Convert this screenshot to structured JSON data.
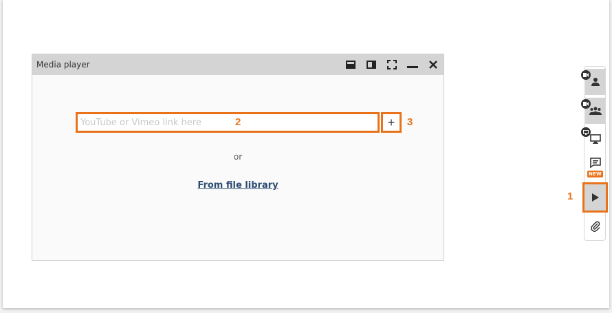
{
  "player": {
    "title": "Media player",
    "input": {
      "value": "",
      "placeholder": "YouTube or Vimeo link here"
    },
    "add_label": "+",
    "or_text": "or",
    "file_library_link": "From file library"
  },
  "callouts": {
    "toolbar_play": "1",
    "link_input": "2",
    "add_button": "3"
  },
  "toolbar": {
    "items": [
      {
        "icon": "user-video-icon"
      },
      {
        "icon": "group-video-icon"
      },
      {
        "icon": "screen-share-icon"
      },
      {
        "icon": "notes-icon",
        "badge": "NEW"
      },
      {
        "icon": "play-icon"
      },
      {
        "icon": "paperclip-icon"
      }
    ]
  },
  "colors": {
    "accent": "#e8731b",
    "titlebar": "#d4d4d4",
    "link": "#2c4a73"
  }
}
